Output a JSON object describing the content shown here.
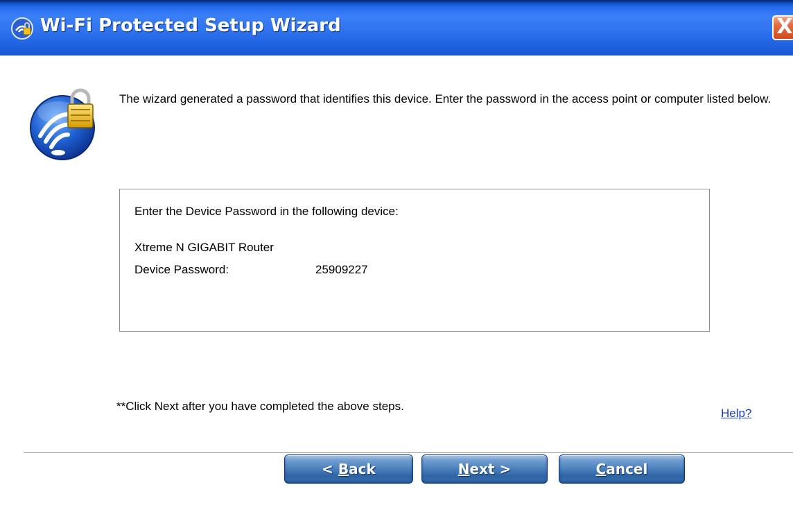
{
  "window": {
    "title": "Wi-Fi Protected Setup Wizard",
    "close_label": "X"
  },
  "main": {
    "intro_text": "The wizard generated a password that identifies this device. Enter the password in the access point or computer listed below.",
    "infobox": {
      "heading": "Enter the Device Password in the following device:",
      "device_name": "Xtreme N GIGABIT Router",
      "password_label": "Device Password:",
      "password_value": "25909227"
    },
    "footnote": "**Click Next after you have completed the above steps.",
    "help_link": "Help?"
  },
  "buttons": {
    "back_prefix": "< ",
    "back_mnemonic": "B",
    "back_rest": "ack",
    "next_mnemonic": "N",
    "next_rest": "ext >",
    "cancel_mnemonic": "C",
    "cancel_rest": "ancel"
  },
  "icons": {
    "title_icon": "wifi-setup-icon",
    "main_icon": "wifi-lock-icon"
  },
  "colors": {
    "titlebar": "#2f73ee",
    "close_button": "#d34a1f",
    "button_blue": "#4a7fbd",
    "link": "#1a3db8"
  }
}
